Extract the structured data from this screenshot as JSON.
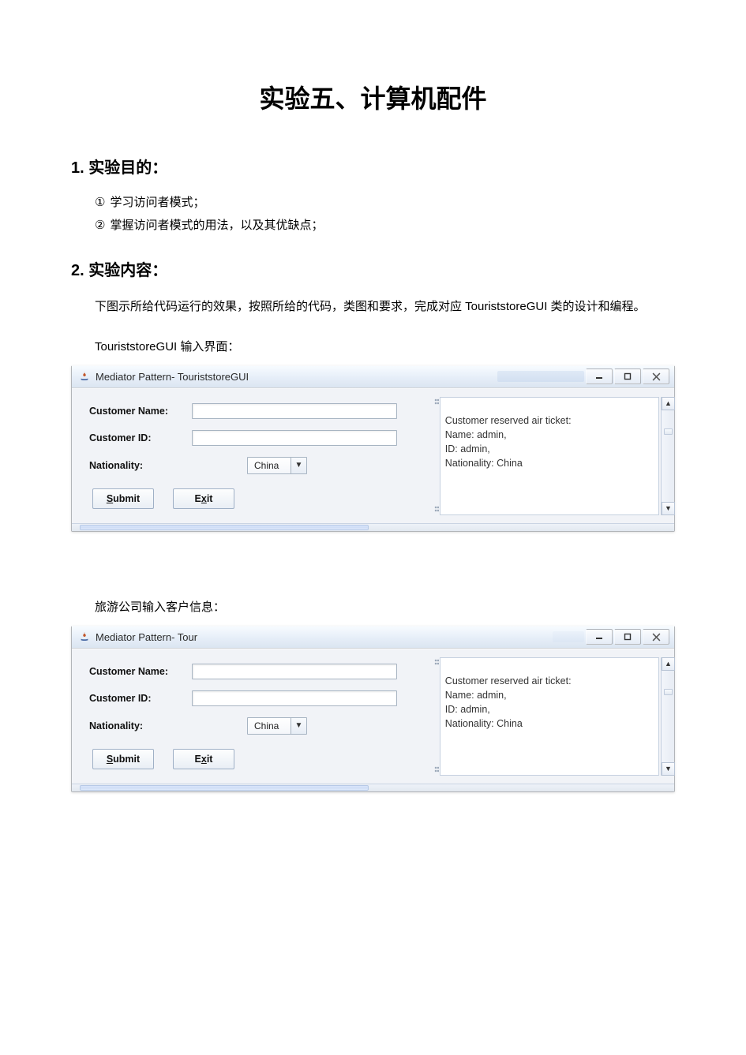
{
  "doc": {
    "title": "实验五、计算机配件",
    "section1": {
      "heading": "1. 实验目的：",
      "items": [
        {
          "marker": "①",
          "text": "学习访问者模式；"
        },
        {
          "marker": "②",
          "text": "掌握访问者模式的用法，以及其优缺点；"
        }
      ]
    },
    "section2": {
      "heading": "2. 实验内容：",
      "para": "下图示所给代码运行的效果，按照所给的代码，类图和要求，完成对应 TouriststoreGUI 类的设计和编程。",
      "caption1": "TouriststoreGUI 输入界面：",
      "caption2": "旅游公司输入客户信息："
    }
  },
  "window1": {
    "title": "Mediator Pattern- TouriststoreGUI",
    "form": {
      "name_label": "Customer Name:",
      "id_label": "Customer ID:",
      "nat_label": "Nationality:",
      "nat_value": "China",
      "submit": "Submit",
      "submit_u": "S",
      "exit_pre": "E",
      "exit_u": "x",
      "exit_post": "it"
    },
    "output": "Customer reserved air ticket:\nName: admin,\nID: admin,\nNationality: China"
  },
  "window2": {
    "title": "Mediator Pattern- Tour",
    "form": {
      "name_label": "Customer Name:",
      "id_label": "Customer ID:",
      "nat_label": "Nationality:",
      "nat_value": "China",
      "submit": "Submit",
      "submit_u": "S",
      "exit_pre": "E",
      "exit_u": "x",
      "exit_post": "it"
    },
    "output": "Customer reserved air ticket:\nName: admin,\nID: admin,\nNationality: China"
  }
}
